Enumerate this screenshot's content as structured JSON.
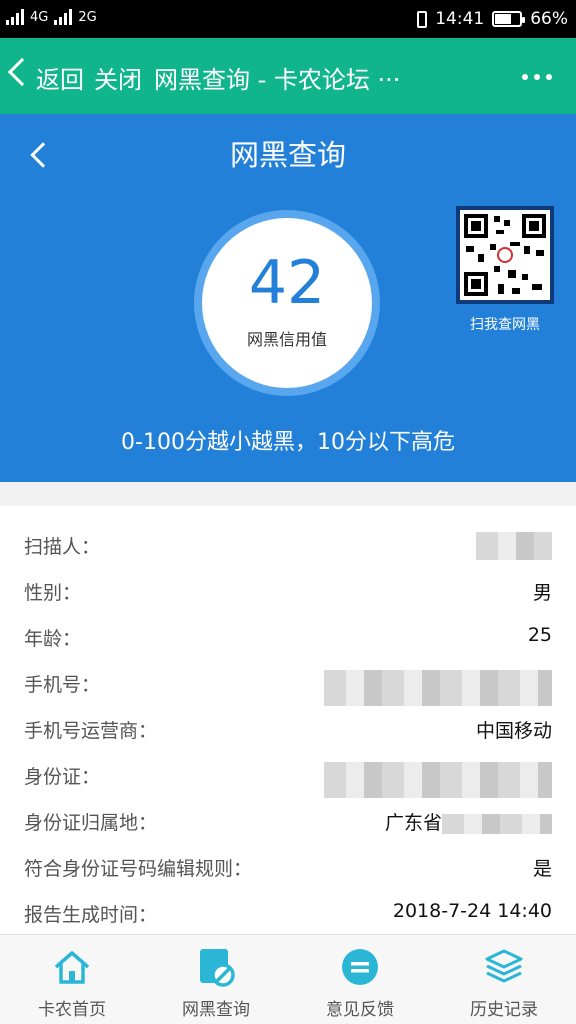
{
  "status_bar": {
    "net_left": "4G",
    "net_right": "2G",
    "time": "14:41",
    "battery": "66%",
    "battery_level": 0.66
  },
  "browser_bar": {
    "back": "返回",
    "close": "关闭",
    "title": "网黑查询 - 卡农论坛 ···"
  },
  "header": {
    "title": "网黑查询",
    "score": "42",
    "score_label": "网黑信用值",
    "qr_label": "扫我查网黑",
    "hint": "0-100分越小越黑，10分以下高危"
  },
  "details": [
    {
      "key": "扫描人：",
      "value": ""
    },
    {
      "key": "性别：",
      "value": "男"
    },
    {
      "key": "年龄：",
      "value": "25"
    },
    {
      "key": "手机号：",
      "value": ""
    },
    {
      "key": "手机号运营商：",
      "value": "中国移动"
    },
    {
      "key": "身份证：",
      "value": ""
    },
    {
      "key": "身份证归属地：",
      "value": "广东省"
    },
    {
      "key": "符合身份证号码编辑规则：",
      "value": "是"
    },
    {
      "key": "报告生成时间：",
      "value": "2018-7-24 14:40"
    }
  ],
  "bottom_nav": [
    {
      "label": "卡农首页",
      "icon": "home-icon"
    },
    {
      "label": "网黑查询",
      "icon": "blacklist-query-icon"
    },
    {
      "label": "意见反馈",
      "icon": "feedback-icon"
    },
    {
      "label": "历史记录",
      "icon": "history-layers-icon"
    }
  ],
  "colors": {
    "green": "#11b58b",
    "blue": "#2280d8",
    "nav_icon": "#2bb6d6"
  }
}
